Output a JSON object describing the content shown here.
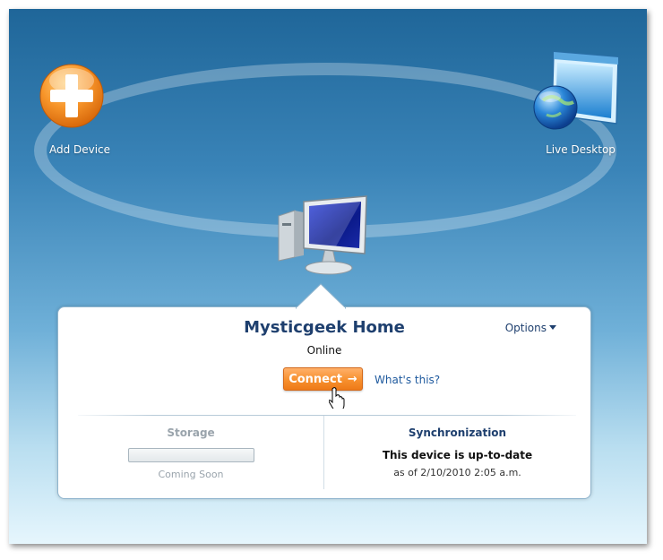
{
  "add_device": {
    "label": "Add Device",
    "icon": "plus-icon",
    "color": "#f39325"
  },
  "live_desktop": {
    "label": "Live Desktop",
    "icon": "globe-window-icon"
  },
  "device": {
    "icon": "monitor-icon",
    "name": "Mysticgeek Home",
    "status": "Online",
    "options_label": "Options",
    "connect_label": "Connect",
    "connect_color": "#f7902e",
    "whats_this_label": "What's this?"
  },
  "storage": {
    "title": "Storage",
    "note": "Coming Soon"
  },
  "sync": {
    "title": "Synchronization",
    "status": "This device is up-to-date",
    "timestamp": "as of 2/10/2010 2:05 a.m."
  },
  "colors": {
    "background_top": "#1f6699",
    "background_bottom": "#e6f6fd",
    "title_text": "#1e3f6e",
    "link": "#1f5a9e"
  }
}
